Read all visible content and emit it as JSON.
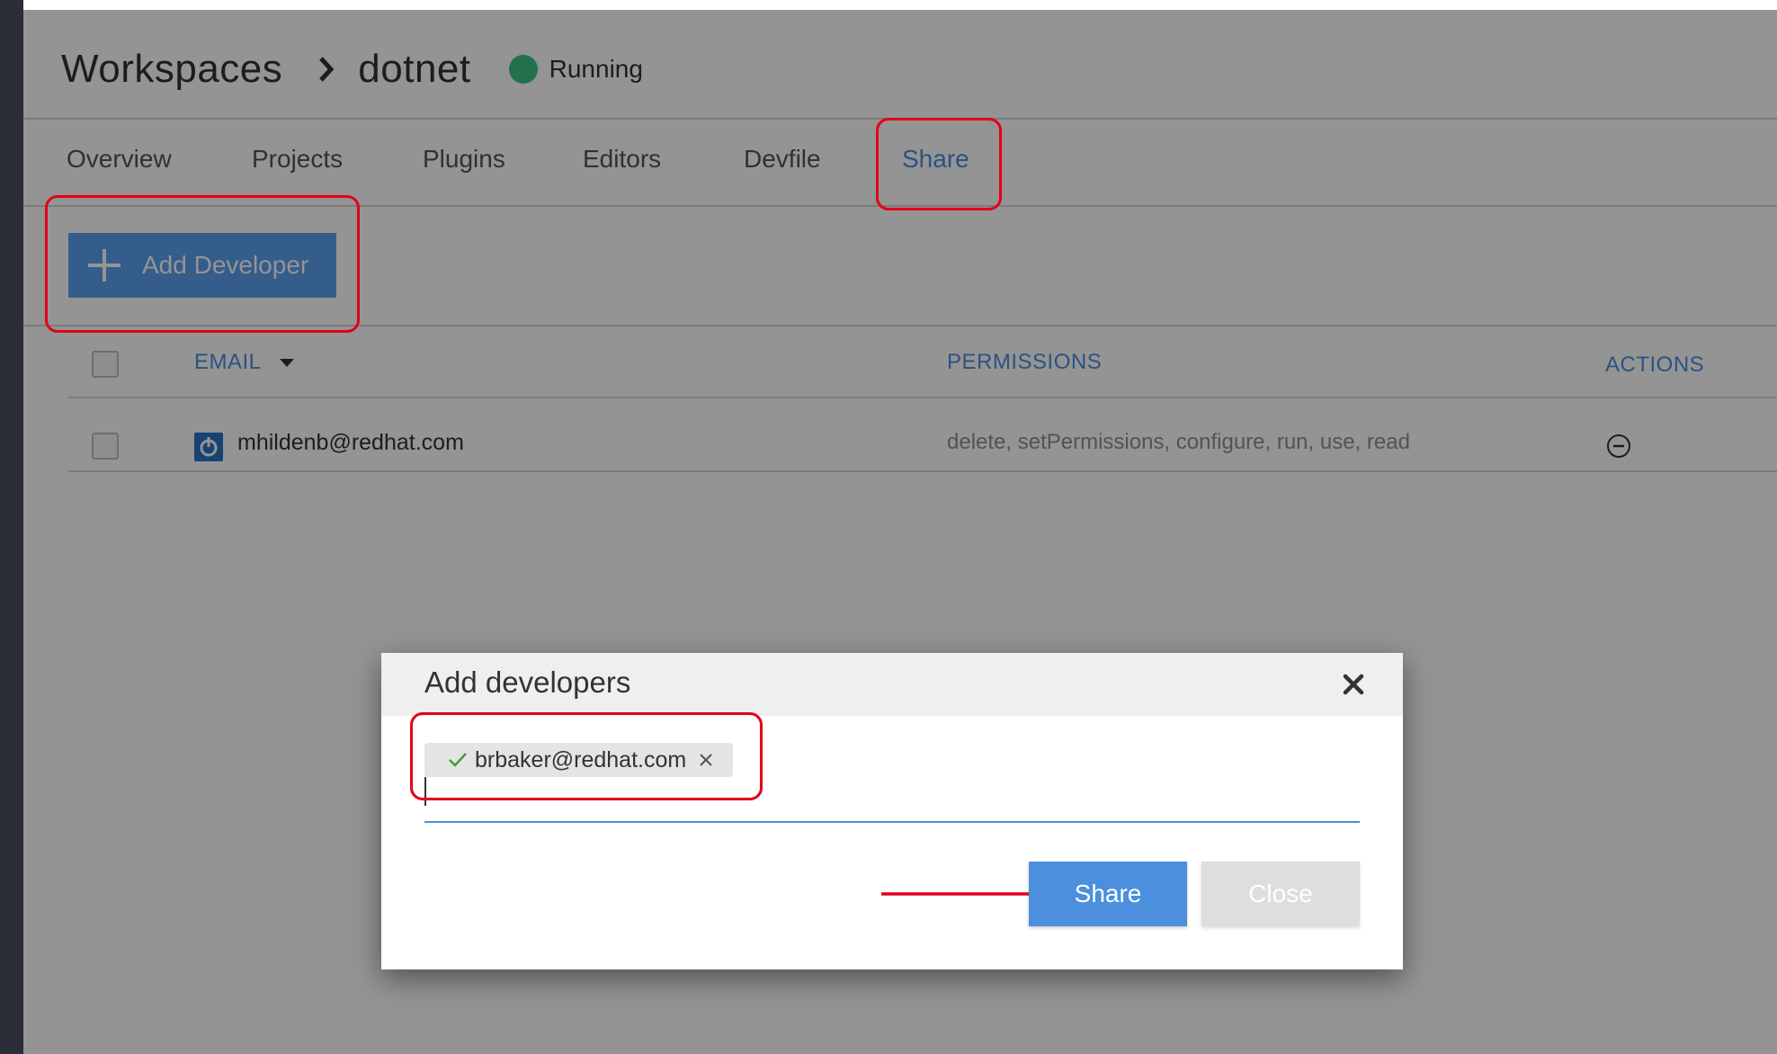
{
  "breadcrumb": {
    "root": "Workspaces",
    "workspace": "dotnet",
    "status": "Running",
    "status_color": "#3dc286"
  },
  "tabs": [
    {
      "label": "Overview",
      "active": false
    },
    {
      "label": "Projects",
      "active": false
    },
    {
      "label": "Plugins",
      "active": false
    },
    {
      "label": "Editors",
      "active": false
    },
    {
      "label": "Devfile",
      "active": false
    },
    {
      "label": "Share",
      "active": true
    }
  ],
  "toolbar": {
    "add_developer_label": "Add Developer",
    "add_developer_icon": "plus-icon"
  },
  "table": {
    "columns": {
      "email": "EMAIL",
      "permissions": "PERMISSIONS",
      "actions": "ACTIONS"
    },
    "rows": [
      {
        "email": "mhildenb@redhat.com",
        "permissions": "delete, setPermissions, configure, run, use, read",
        "action_icon": "remove-icon"
      }
    ]
  },
  "modal": {
    "title": "Add developers",
    "chips": [
      {
        "email": "brbaker@redhat.com",
        "valid": true
      }
    ],
    "input_value": "",
    "share_label": "Share",
    "close_label": "Close"
  },
  "colors": {
    "accent": "#4b8fdd",
    "highlight": "#e3001a"
  }
}
